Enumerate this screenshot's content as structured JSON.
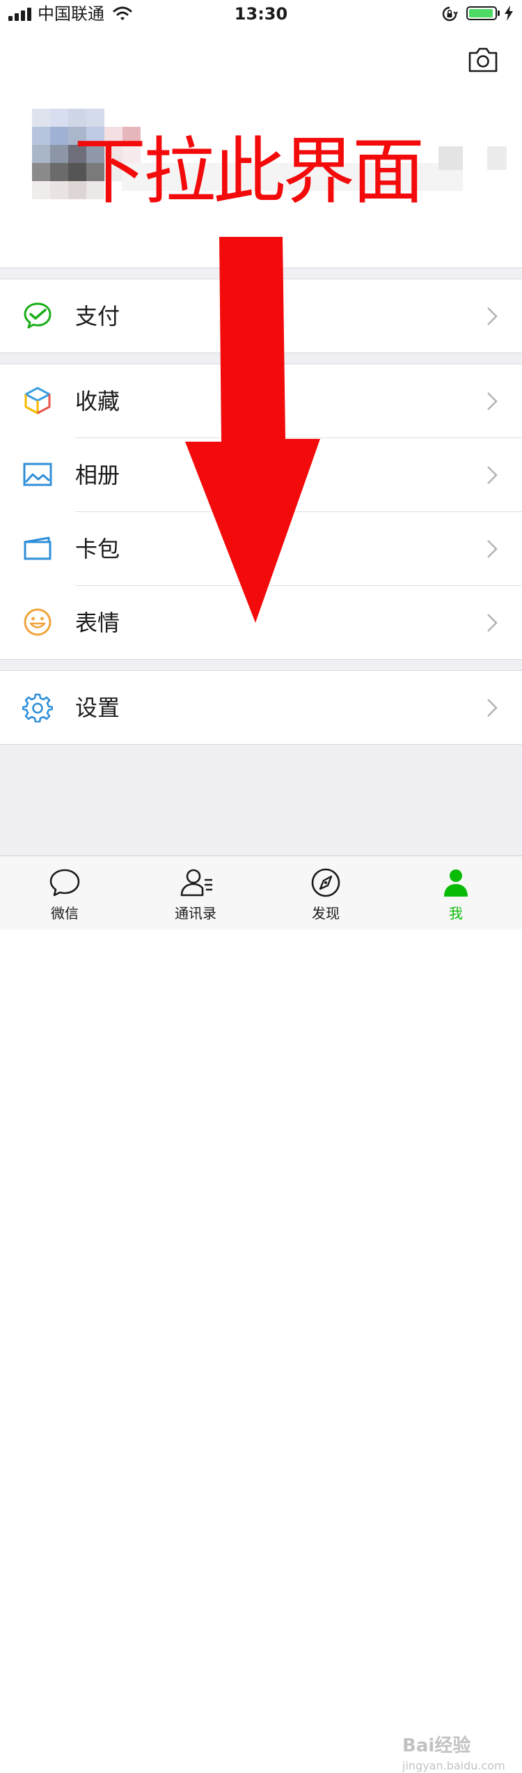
{
  "status_bar": {
    "carrier": "中国联通",
    "time": "13:30",
    "battery_level": 0.95
  },
  "header": {
    "camera_icon": "camera-icon"
  },
  "annotation": {
    "text": "下拉此界面",
    "color": "#f30a0a"
  },
  "menu": {
    "pay": {
      "label": "支付",
      "icon": "wechat-pay-icon"
    },
    "favorites": {
      "label": "收藏",
      "icon": "cube-icon"
    },
    "album": {
      "label": "相册",
      "icon": "picture-icon"
    },
    "cards": {
      "label": "卡包",
      "icon": "card-wallet-icon"
    },
    "stickers": {
      "label": "表情",
      "icon": "smiley-icon"
    },
    "settings": {
      "label": "设置",
      "icon": "gear-icon"
    }
  },
  "tabs": [
    {
      "label": "微信",
      "icon": "chat-bubble-icon",
      "active": false
    },
    {
      "label": "通讯录",
      "icon": "contacts-icon",
      "active": false
    },
    {
      "label": "发现",
      "icon": "compass-icon",
      "active": false
    },
    {
      "label": "我",
      "icon": "person-icon",
      "active": true
    }
  ],
  "watermark": {
    "text": "Bai经验",
    "sub": "jingyan.baidu.com"
  },
  "colors": {
    "accent_green": "#09bb07",
    "page_background": "#efeff4",
    "annotation_red": "#f30a0a"
  }
}
